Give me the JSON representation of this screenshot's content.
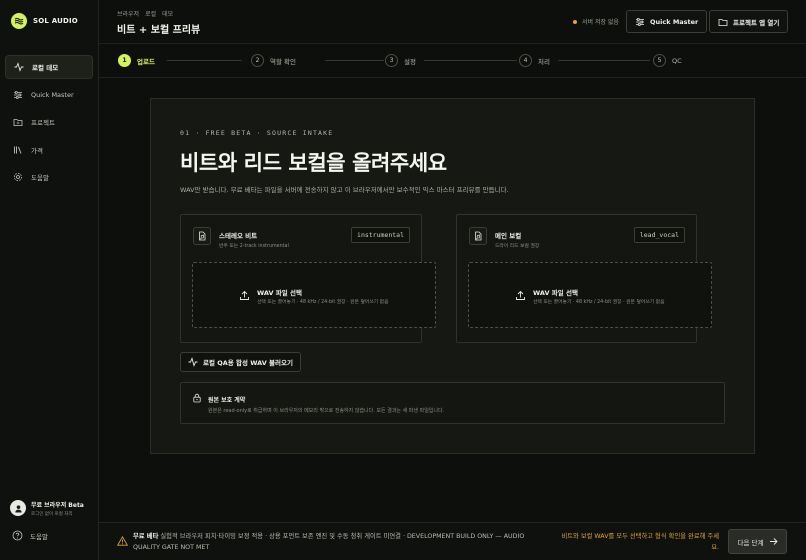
{
  "brand": {
    "name": "SOL AUDIO",
    "logo_icon": "sound-wave-icon"
  },
  "sidebar": {
    "items": [
      {
        "label": "로컬 데모",
        "icon": "activity-icon",
        "active": true
      },
      {
        "label": "Quick Master",
        "icon": "sliders-icon",
        "active": false
      },
      {
        "label": "프로젝트",
        "icon": "folder-icon",
        "active": false
      },
      {
        "label": "가격",
        "icon": "library-icon",
        "active": false
      },
      {
        "label": "도움말",
        "icon": "gear-icon",
        "active": false
      }
    ],
    "user": {
      "name": "무료 브라우저 Beta",
      "subtitle": "로그인 없이 로컬 처리"
    },
    "help_label": "도움말"
  },
  "header": {
    "breadcrumbs": [
      "브라우저",
      "로컬",
      "데모"
    ],
    "title": "비트 + 보컬 프리뷰",
    "save_status": "서버 저장 없음",
    "quick_master_label": "Quick Master",
    "open_project_label": "프로젝트 앱 열기"
  },
  "stepper": {
    "steps": [
      {
        "num": "1",
        "label": "업로드",
        "active": true
      },
      {
        "num": "2",
        "label": "역할 확인",
        "active": false
      },
      {
        "num": "3",
        "label": "설정",
        "active": false
      },
      {
        "num": "4",
        "label": "처리",
        "active": false
      },
      {
        "num": "5",
        "label": "QC",
        "active": false
      }
    ]
  },
  "main": {
    "eyebrow": "01 · FREE BETA · SOURCE INTAKE",
    "heading": "비트와 리드 보컬을 올려주세요",
    "lead": "WAV만 받습니다. 무료 베타는 파일을 서버에 전송하지 않고 이 브라우저에서만 보수적인 믹스 마스터 프리뷰를 만듭니다.",
    "cards": [
      {
        "title": "스테레오 비트",
        "subtitle": "반주 또는 2-track instrumental",
        "tag": "instrumental",
        "drop_title": "WAV 파일 선택",
        "drop_sub": "선택 또는 끌어놓기 · 48 kHz / 24-bit 권장 · 원본 덮어쓰기 없음"
      },
      {
        "title": "메인 보컬",
        "subtitle": "드라이 리드 보컬 권장",
        "tag": "lead_vocal",
        "drop_title": "WAV 파일 선택",
        "drop_sub": "선택 또는 끌어놓기 · 48 kHz / 24-bit 권장 · 원본 덮어쓰기 없음"
      }
    ],
    "demo_button": "로컬 QA용 합성 WAV 불러오기",
    "protect": {
      "title": "원본 보호 계약",
      "text": "원본은 read-only로 취급하며 이 브라우저의 메모리 밖으로 전송하지 않습니다. 모든 결과는 새 파생 파일입니다."
    }
  },
  "footer": {
    "note_strong": "무료 베타",
    "note": " 실험적 브라우저 피치·타이밍 보정 적용 · 상용 포먼트 보존 엔진 및 수동 청취 게이트 미연결 · DEVELOPMENT BUILD ONLY — AUDIO QUALITY GATE NOT MET",
    "hint": "비트와 보컬 WAV를 모두 선택하고 형식 확인을 완료해 주세요.",
    "next_label": "다음 단계"
  },
  "colors": {
    "accent": "#d4f25a",
    "warning": "#e0a23a",
    "background": "#0d0f0c"
  }
}
